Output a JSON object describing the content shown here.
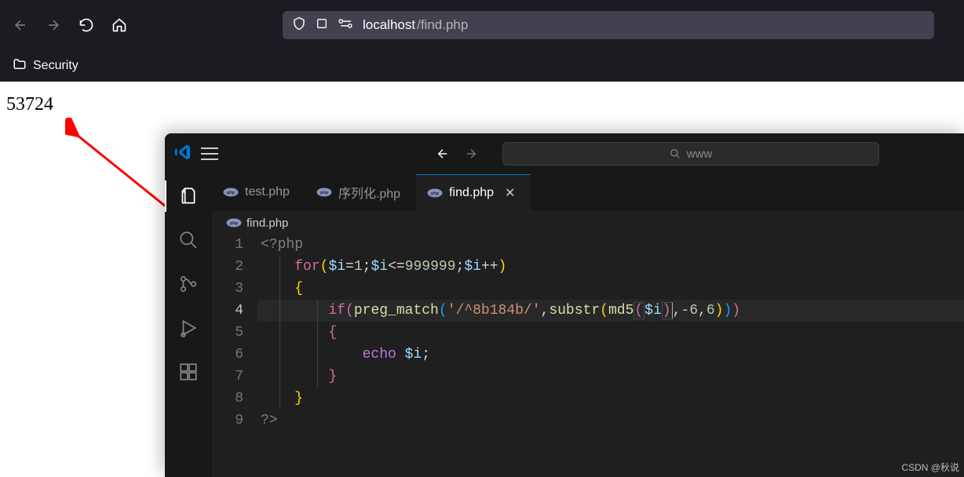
{
  "browser": {
    "url_text": "localhost/find.php",
    "url_host": "localhost",
    "url_path": "/find.php",
    "bookmark": "Security",
    "page_output": "53724"
  },
  "vscode": {
    "search_placeholder": "www",
    "tabs": [
      {
        "label": "test.php"
      },
      {
        "label": "序列化.php"
      },
      {
        "label": "find.php"
      }
    ],
    "breadcrumb": "find.php",
    "gutter": [
      "1",
      "2",
      "3",
      "4",
      "5",
      "6",
      "7",
      "8",
      "9"
    ],
    "code": {
      "php_open": "<?php",
      "for_kw": "for",
      "var_i": "$i",
      "assign": "=",
      "one": "1",
      "semi": ";",
      "lte": "<=",
      "max": "999999",
      "inc": "++",
      "lbrace": "{",
      "rbrace": "}",
      "if_kw": "if",
      "preg": "preg_match",
      "pattern": "'/^8b184b/'",
      "comma": ",",
      "substr": "substr",
      "md5": "md5",
      "neg6a": "-6",
      "six": "6",
      "echo": "echo",
      "php_close": "?>"
    }
  },
  "watermark": "CSDN @秋说"
}
